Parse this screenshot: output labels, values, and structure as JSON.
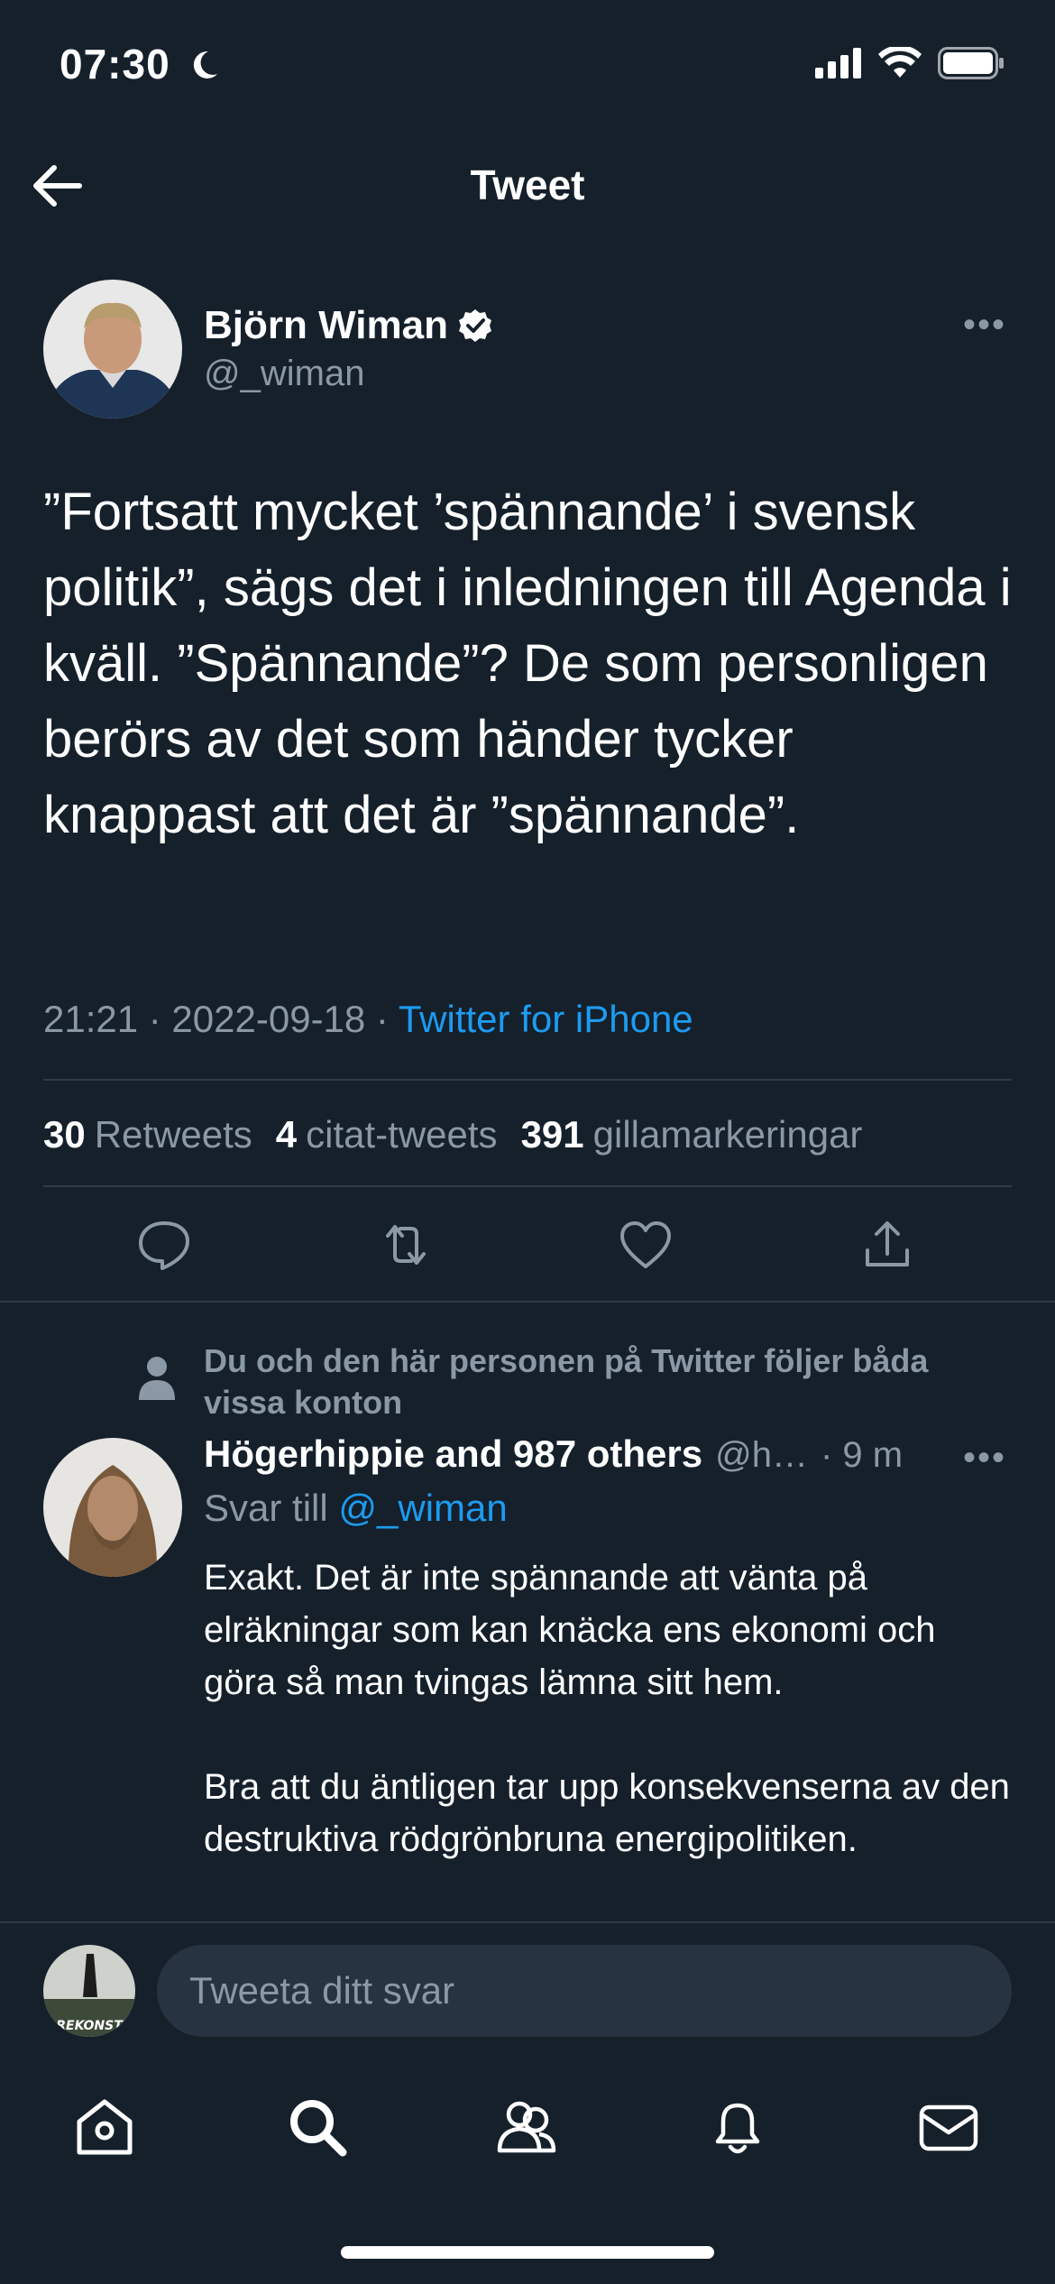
{
  "status_bar": {
    "time": "07:30"
  },
  "header": {
    "title": "Tweet"
  },
  "tweet": {
    "author_name": "Björn Wiman",
    "author_handle": "@_wiman",
    "text": "”Fortsatt mycket ’spännande’ i svensk politik”, sägs det i inledningen till Agenda i kväll. ”Spännande”? De som personligen berörs av det som händer tycker knappast att det är ”spännande”.",
    "time": "21:21 · 2022-09-18 ·",
    "source": "Twitter for iPhone",
    "retweets_count": "30",
    "retweets_label": "Retweets",
    "quotes_count": "4",
    "quotes_label": "citat-tweets",
    "likes_count": "391",
    "likes_label": "gillamarkeringar"
  },
  "reply": {
    "social_context": "Du och den här personen på Twitter följer båda vissa konton",
    "name": "Högerhippie and 987 others",
    "handle": "@h…",
    "age": "· 9 m",
    "reply_to_label": "Svar till",
    "reply_to_handle": "@_wiman",
    "text": "Exakt. Det är inte spännande att vänta på elräkningar som kan knäcka ens ekonomi och göra så man tvingas lämna sitt hem.\n\nBra att du äntligen tar upp konsekvenserna av den destruktiva rödgrönbruna energipolitiken."
  },
  "compose": {
    "placeholder": "Tweeta ditt svar",
    "avatar_text": "REKONST"
  },
  "colors": {
    "background": "#15202b",
    "accent": "#1d9bf0",
    "muted": "#8b98a5"
  }
}
